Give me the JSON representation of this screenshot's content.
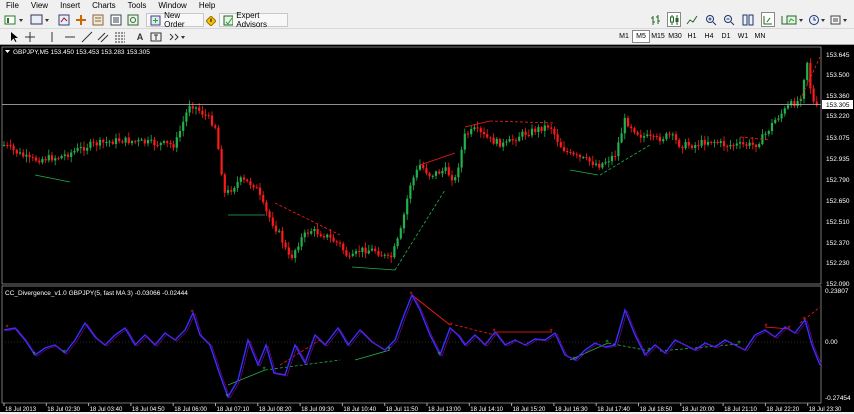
{
  "menu": [
    "File",
    "View",
    "Insert",
    "Charts",
    "Tools",
    "Window",
    "Help"
  ],
  "toolbar": {
    "new_order_label": "New Order",
    "expert_advisors_label": "Expert Advisors",
    "timeframes": [
      "M1",
      "M5",
      "M15",
      "M30",
      "H1",
      "H4",
      "D1",
      "W1",
      "MN"
    ],
    "active_timeframe": "M5"
  },
  "main_chart": {
    "info": "GBPJPY,M5  153.450 153.453 153.283 153.305",
    "price_labels": [
      "153.645",
      "153.500",
      "153.360",
      "153.220",
      "153.075",
      "152.935",
      "152.790",
      "152.650",
      "152.510",
      "152.370",
      "152.230",
      "152.090"
    ],
    "current_price": "153.305"
  },
  "indicator": {
    "info": "CC_Divergence_v1.0 GBPJPY(5, fast MA 3) -0.03066 -0.02444",
    "labels": [
      "0.23807",
      "0.00",
      "-0.27454"
    ]
  },
  "time_labels": [
    "18 Jul 2013",
    "18 Jul 02:30",
    "18 Jul 03:40",
    "18 Jul 04:50",
    "18 Jul 06:00",
    "18 Jul 07:10",
    "18 Jul 08:20",
    "18 Jul 09:30",
    "18 Jul 10:40",
    "18 Jul 11:50",
    "18 Jul 13:00",
    "18 Jul 14:10",
    "18 Jul 15:20",
    "18 Jul 16:30",
    "18 Jul 17:40",
    "18 Jul 18:50",
    "18 Jul 20:00",
    "18 Jul 21:10",
    "18 Jul 22:20",
    "18 Jul 23:30"
  ],
  "colors": {
    "bull": "#22b14c",
    "bear": "#ff1a1a",
    "osc": "#3333ff",
    "bg": "#000000"
  }
}
